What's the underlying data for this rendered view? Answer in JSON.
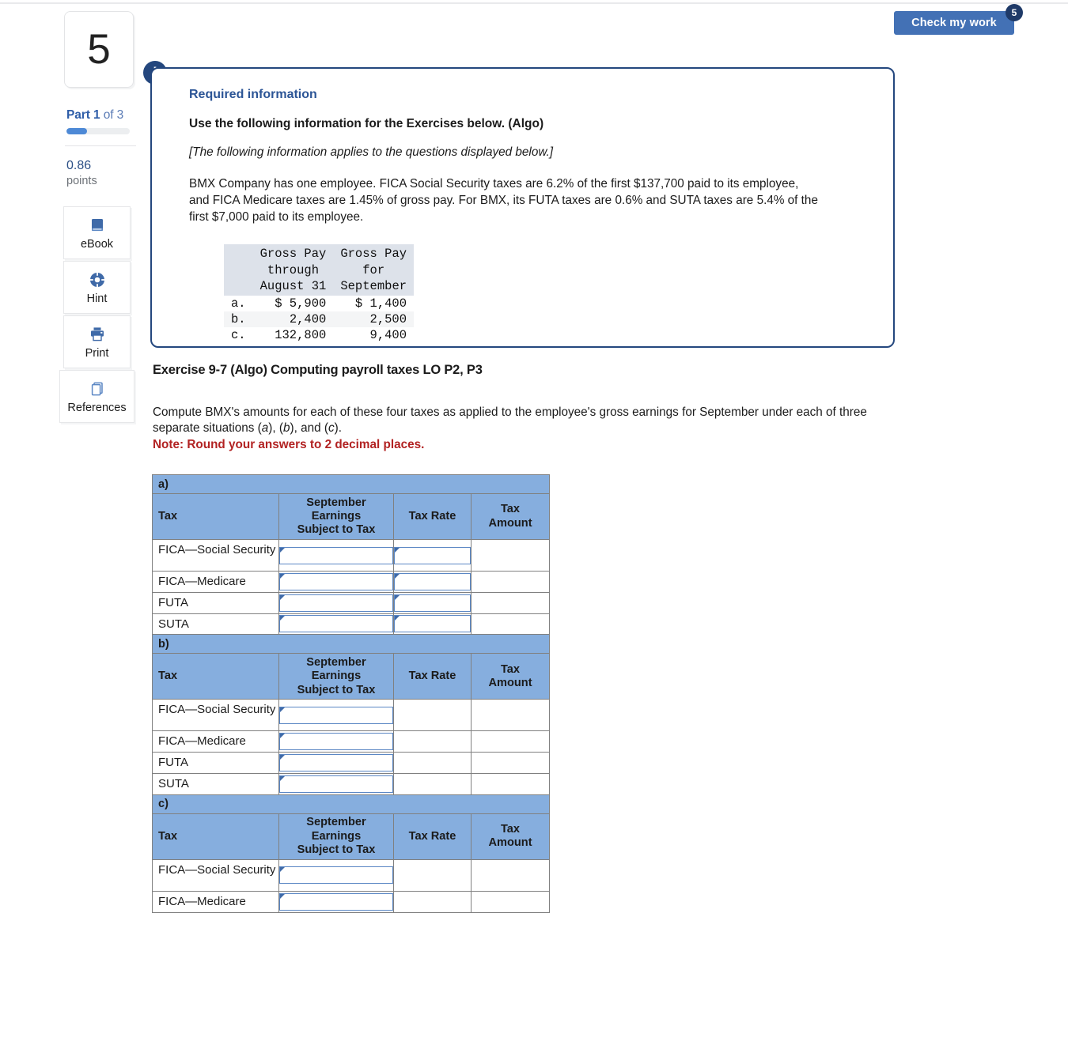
{
  "header": {
    "check_button_label": "Check my work",
    "check_badge_count": "5"
  },
  "rail": {
    "question_number": "5",
    "part_prefix": "Part 1",
    "part_suffix": " of 3",
    "progress_percent": 33,
    "points_value": "0.86",
    "points_label": "points",
    "tools": [
      {
        "name": "ebook",
        "label": "eBook",
        "icon": "book-icon"
      },
      {
        "name": "hint",
        "label": "Hint",
        "icon": "lifebuoy-icon"
      },
      {
        "name": "print",
        "label": "Print",
        "icon": "printer-icon"
      },
      {
        "name": "references",
        "label": "References",
        "icon": "copy-icon"
      }
    ]
  },
  "callout": {
    "badge_icon": "exclamation-icon",
    "badge_glyph": "!",
    "title": "Required information",
    "subtitle": "Use the following information for the Exercises below. (Algo)",
    "italic_note": "[The following information applies to the questions displayed below.]",
    "body": "BMX Company has one employee. FICA Social Security taxes are 6.2% of the first $137,700 paid to its employee, and FICA Medicare taxes are 1.45% of gross pay. For BMX, its FUTA taxes are 0.6% and SUTA taxes are 5.4% of the first $7,000 paid to its employee.",
    "gross_pay_table": {
      "headers": [
        "",
        "Gross Pay\nthrough\nAugust 31",
        "Gross Pay\nfor\nSeptember"
      ],
      "rows": [
        {
          "label": "a.",
          "through_aug": "$ 5,900",
          "for_sept": "$ 1,400"
        },
        {
          "label": "b.",
          "through_aug": "2,400",
          "for_sept": "2,500"
        },
        {
          "label": "c.",
          "through_aug": "132,800",
          "for_sept": "9,400"
        }
      ]
    }
  },
  "exercise": {
    "title": "Exercise 9-7 (Algo) Computing payroll taxes LO P2, P3",
    "prompt_part1": "Compute BMX's amounts for each of these four taxes as applied to the employee's gross earnings for September under each of three separate situations (",
    "prompt_a": "a",
    "prompt_mid1": "), (",
    "prompt_b": "b",
    "prompt_mid2": "), and (",
    "prompt_c": "c",
    "prompt_end": ").",
    "note": "Note: Round your answers to 2 decimal places."
  },
  "answer_tables": {
    "column_headers": [
      "Tax",
      "September Earnings Subject to Tax",
      "Tax Rate",
      "Tax Amount"
    ],
    "column_header_tax": "Tax",
    "column_header_earnings": "September\nEarnings\nSubject to Tax",
    "column_header_rate": "Tax Rate",
    "column_header_amount": "Tax\nAmount",
    "sections": [
      {
        "label": "a)",
        "rows": [
          {
            "tax": "FICA—Social Security",
            "earnings_input": true,
            "rate_input": true,
            "amount_input": false,
            "tall": true
          },
          {
            "tax": "FICA—Medicare",
            "earnings_input": true,
            "rate_input": true,
            "amount_input": false,
            "tall": false
          },
          {
            "tax": "FUTA",
            "earnings_input": true,
            "rate_input": true,
            "amount_input": false,
            "tall": false
          },
          {
            "tax": "SUTA",
            "earnings_input": true,
            "rate_input": true,
            "amount_input": false,
            "tall": false
          }
        ]
      },
      {
        "label": "b)",
        "rows": [
          {
            "tax": "FICA—Social Security",
            "earnings_input": true,
            "rate_input": false,
            "amount_input": false,
            "tall": true
          },
          {
            "tax": "FICA—Medicare",
            "earnings_input": true,
            "rate_input": false,
            "amount_input": false,
            "tall": false
          },
          {
            "tax": "FUTA",
            "earnings_input": true,
            "rate_input": false,
            "amount_input": false,
            "tall": false
          },
          {
            "tax": "SUTA",
            "earnings_input": true,
            "rate_input": false,
            "amount_input": false,
            "tall": false
          }
        ]
      },
      {
        "label": "c)",
        "rows": [
          {
            "tax": "FICA—Social Security",
            "earnings_input": true,
            "rate_input": false,
            "amount_input": false,
            "tall": true
          },
          {
            "tax": "FICA—Medicare",
            "earnings_input": true,
            "rate_input": false,
            "amount_input": false,
            "tall": false
          }
        ]
      }
    ]
  },
  "colors": {
    "accent_blue": "#4371b5",
    "callout_border": "#24477e",
    "table_header_blue": "#86aede",
    "input_border": "#5b87c4",
    "note_red": "#b22222",
    "mono_header_bg": "#dde2ea"
  }
}
